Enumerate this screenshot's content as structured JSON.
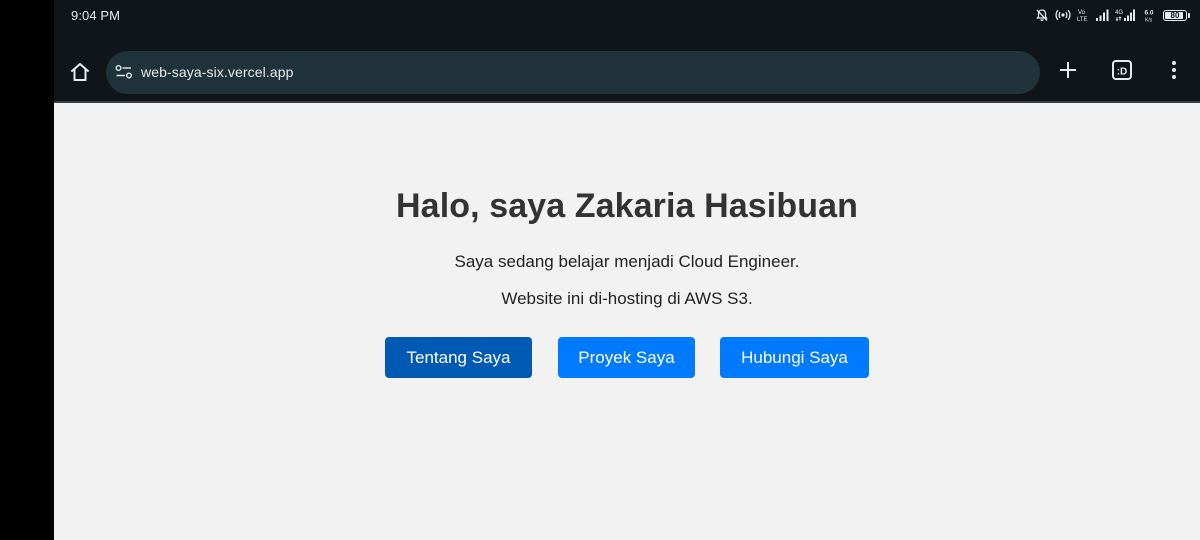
{
  "status_bar": {
    "time": "9:04 PM",
    "battery_level": "80",
    "icons": [
      "mute-icon",
      "hotspot-icon",
      "volte-icon",
      "signal-icon",
      "4g-signal-icon",
      "network-speed-icon",
      "battery-icon"
    ],
    "network_speed": "6.0"
  },
  "toolbar": {
    "url": "web-saya-six.vercel.app",
    "tabs_label": ":D"
  },
  "page": {
    "title": "Halo, saya Zakaria Hasibuan",
    "subtitle": "Saya sedang belajar menjadi Cloud Engineer.",
    "subtitle_2": "Website ini di-hosting di AWS S3.",
    "buttons": [
      {
        "label": "Tentang Saya",
        "color": "#0059b3"
      },
      {
        "label": "Proyek Saya",
        "color": "#007bff"
      },
      {
        "label": "Hubungi Saya",
        "color": "#007bff"
      }
    ]
  },
  "colors": {
    "browser_chrome": "#0f1519",
    "url_bar": "#21333a",
    "page_background": "#f2f2f2",
    "primary": "#007bff",
    "primary_active": "#0059b3"
  }
}
